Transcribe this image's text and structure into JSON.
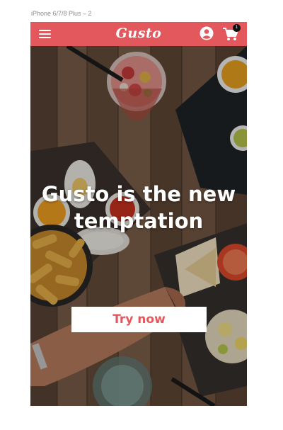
{
  "artboard": {
    "label": "iPhone 6/7/8 Plus – 2"
  },
  "navbar": {
    "logo": "Gusto",
    "cart_count": "1",
    "color": "#e2585c"
  },
  "hero": {
    "headline_line1": "Gusto is the new",
    "headline_line2": "temptation",
    "cta_label": "Try now",
    "cta_text_color": "#e2585c"
  },
  "icons": {
    "menu": "hamburger-icon",
    "profile": "user-icon",
    "cart": "cart-icon"
  }
}
